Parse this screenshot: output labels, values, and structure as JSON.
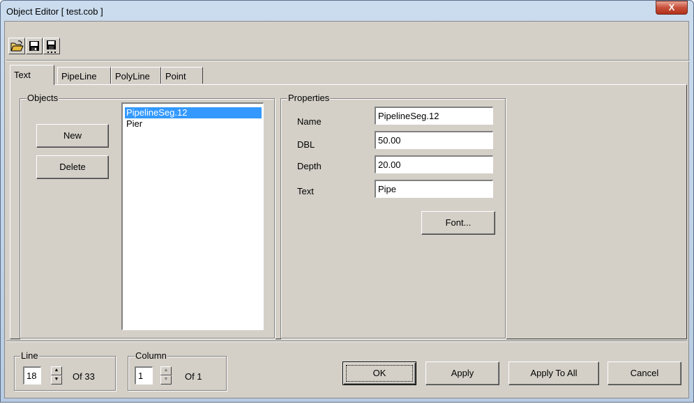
{
  "window": {
    "title": "Object Editor [ test.cob ]",
    "close_label": "X"
  },
  "toolbar": {
    "open": "open-folder-icon",
    "save": "save-icon",
    "save_as": "save-as-icon"
  },
  "tabs": [
    {
      "label": "Text",
      "active": true
    },
    {
      "label": "PipeLine",
      "active": false
    },
    {
      "label": "PolyLine",
      "active": false
    },
    {
      "label": "Point",
      "active": false
    }
  ],
  "objects": {
    "label": "Objects",
    "new_label": "New",
    "delete_label": "Delete",
    "items": [
      {
        "label": "PipelineSeg.12",
        "selected": true
      },
      {
        "label": "Pier",
        "selected": false
      }
    ]
  },
  "properties": {
    "label": "Properties",
    "fields": [
      {
        "label": "Name",
        "value": "PipelineSeg.12"
      },
      {
        "label": "DBL",
        "value": "50.00"
      },
      {
        "label": "Depth",
        "value": "20.00"
      },
      {
        "label": "Text",
        "value": "Pipe"
      }
    ],
    "font_label": "Font..."
  },
  "line": {
    "label": "Line",
    "value": "18",
    "of": "Of 33"
  },
  "column": {
    "label": "Column",
    "value": "1",
    "of": "Of 1"
  },
  "actions": {
    "ok": "OK",
    "apply": "Apply",
    "apply_all": "Apply To All",
    "cancel": "Cancel"
  },
  "colors": {
    "selection": "#3399ff",
    "dialog_face": "#d4d0c8",
    "close_red": "#c7503a"
  }
}
